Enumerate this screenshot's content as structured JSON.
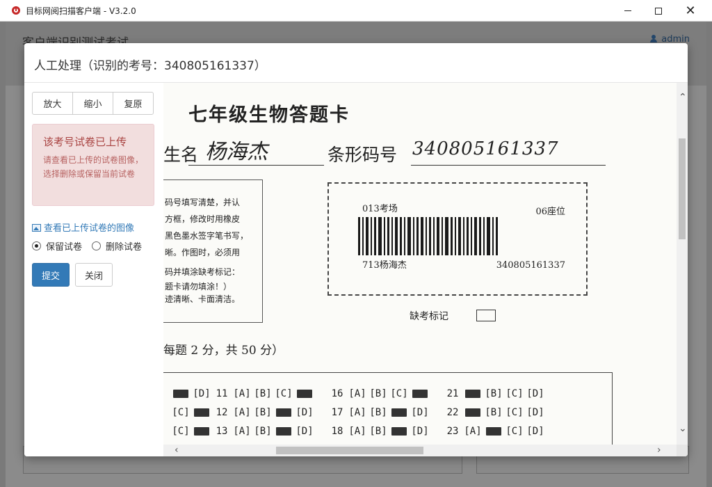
{
  "window": {
    "title": "目标网阅扫描客户端 - V3.2.0",
    "min_icon": "minimize-icon",
    "max_icon": "maximize-icon",
    "close_icon": "close-icon",
    "close_glyph": "✕"
  },
  "background": {
    "page_title": "客户端识别测试考试",
    "user": "admin"
  },
  "modal": {
    "title": "人工处理（识别的考号：340805161337）",
    "zoom_in": "放大",
    "zoom_out": "缩小",
    "reset": "复原",
    "alert_title": "该考号试卷已上传",
    "alert_text": "请查看已上传的试卷图像，选择删除或保留当前试卷",
    "view_link": "查看已上传试卷的图像",
    "keep_label": "保留试卷",
    "delete_label": "删除试卷",
    "selected_option": "保留试卷",
    "submit": "提交",
    "close": "关闭",
    "accent_color": "#337ab7",
    "alert_color": "#f2dede"
  },
  "sheet": {
    "title": "七年级生物答题卡",
    "name_label": "生名",
    "name_value": "杨海杰",
    "barcode_label": "条形码号",
    "barcode_value": "340805161337",
    "notes": [
      "码号填写清楚，并认",
      "方框，修改时用橡皮",
      "黑色墨水签字笔书写，",
      "晰。作图时，必须用",
      "码并填涂缺考标记：",
      "题卡请勿填涂！）",
      "迹清晰、卡面清洁。"
    ],
    "barcode_room": "013考场",
    "barcode_seat": "06座位",
    "barcode_name": "713杨海杰",
    "barcode_number": "340805161337",
    "absent_label": "缺考标记",
    "section_title": "每题 2 分，共 50 分）",
    "rows": [
      {
        "c1": "[D]",
        "n1": "11",
        "a": "[A]",
        "b": "[B]",
        "c": "[C]",
        "n2": "16",
        "a2": "[A]",
        "b2": "[B]",
        "c2": "[C]",
        "n3": "21",
        "b3": "[B]",
        "c3": "[C]",
        "d3": "[D]"
      },
      {
        "c1": "[C]",
        "n1": "12",
        "a": "[A]",
        "b": "[B]",
        "c": "[D]",
        "n2": "17",
        "a2": "[A]",
        "b2": "[B]",
        "c2": "[D]",
        "n3": "22",
        "b3": "[B]",
        "c3": "[C]",
        "d3": "[D]"
      },
      {
        "c1": "[C]",
        "n1": "13",
        "a": "[A]",
        "b": "[B]",
        "c": "[D]",
        "n2": "18",
        "a2": "[A]",
        "b2": "[B]",
        "c2": "[D]",
        "n3": "23",
        "b3": "[A]",
        "c3": "[C]",
        "d3": "[D]"
      }
    ]
  }
}
